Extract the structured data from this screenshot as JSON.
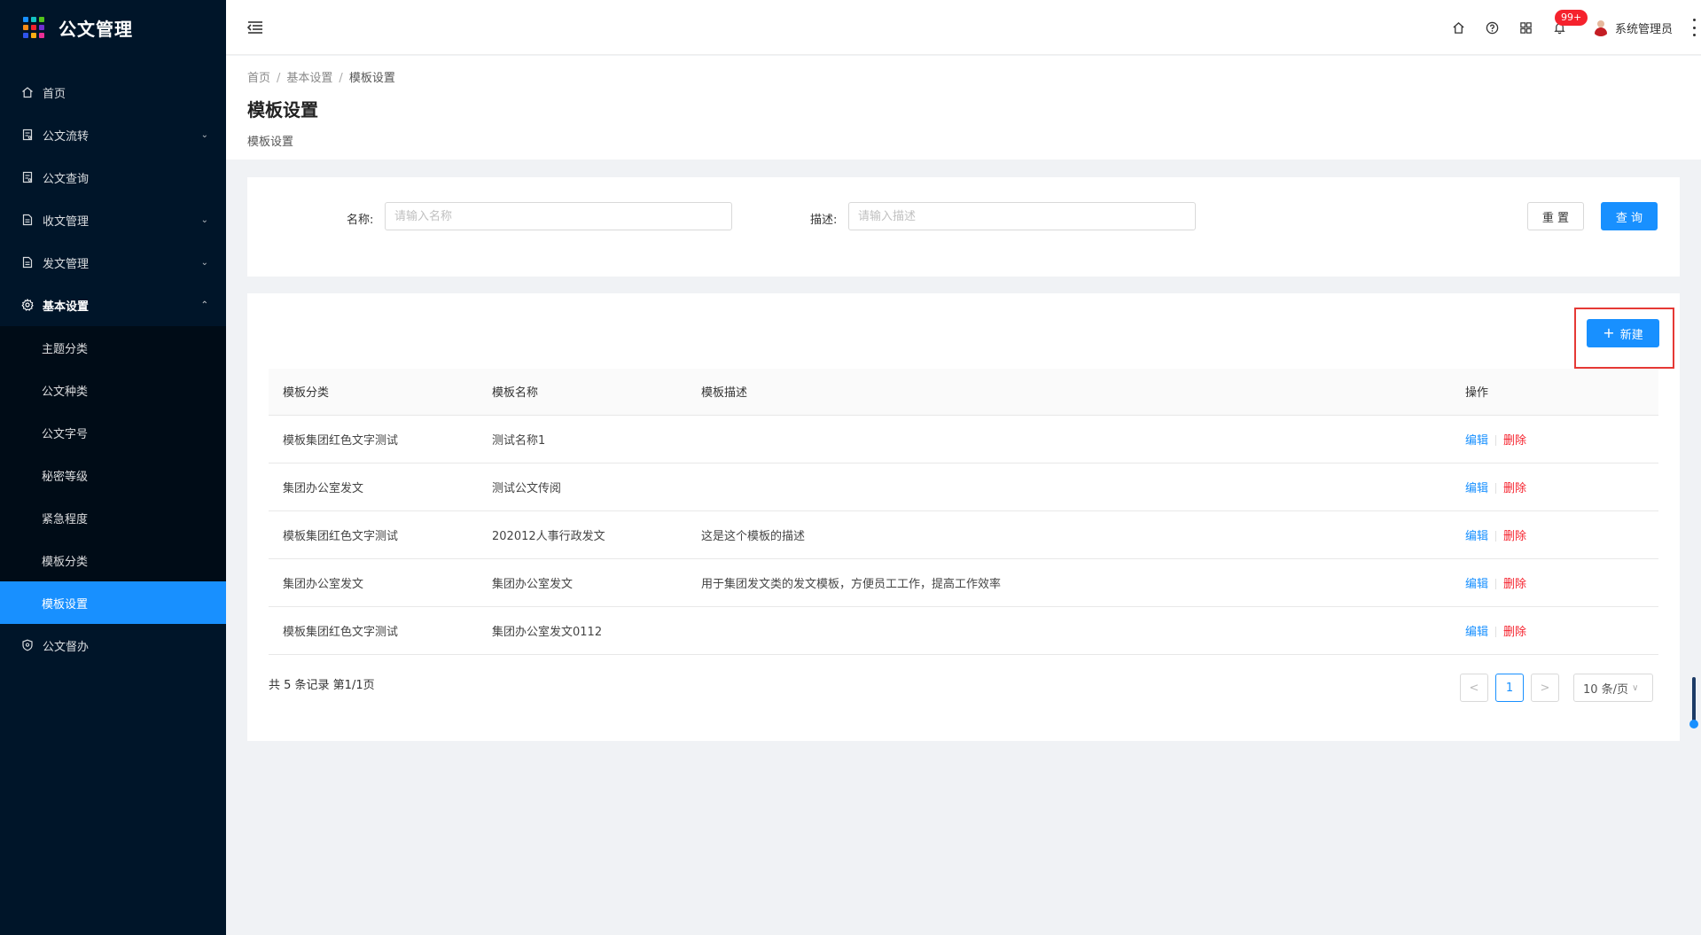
{
  "app": {
    "title": "公文管理"
  },
  "sidebar": {
    "logo_colors": [
      "#1890ff",
      "#13c2c2",
      "#52c41a",
      "#fa8c16",
      "#f5222d",
      "#722ed1",
      "#2f54eb",
      "#faad14",
      "#eb2f96"
    ],
    "items": [
      {
        "label": "首页",
        "icon": "home-icon"
      },
      {
        "label": "公文流转",
        "icon": "doc-icon",
        "arrow": "⌄"
      },
      {
        "label": "公文查询",
        "icon": "doc-icon"
      },
      {
        "label": "收文管理",
        "icon": "file-icon",
        "arrow": "⌄"
      },
      {
        "label": "发文管理",
        "icon": "file-icon",
        "arrow": "⌄"
      },
      {
        "label": "基本设置",
        "icon": "gear-icon",
        "arrow": "⌃"
      }
    ],
    "sub_items": [
      {
        "label": "主题分类"
      },
      {
        "label": "公文种类"
      },
      {
        "label": "公文字号"
      },
      {
        "label": "秘密等级"
      },
      {
        "label": "紧急程度"
      },
      {
        "label": "模板分类"
      },
      {
        "label": "模板设置"
      }
    ],
    "last_item": {
      "label": "公文督办",
      "icon": "shield-icon"
    }
  },
  "header": {
    "badge": "99+",
    "user_name": "系统管理员"
  },
  "breadcrumb": [
    "首页",
    "基本设置",
    "模板设置"
  ],
  "breadcrumb_sep": "/",
  "page": {
    "title": "模板设置",
    "subtitle": "模板设置"
  },
  "search": {
    "name_label": "名称:",
    "name_placeholder": "请输入名称",
    "desc_label": "描述:",
    "desc_placeholder": "请输入描述",
    "reset_label": "重 置",
    "query_label": "查 询"
  },
  "toolbar": {
    "new_label": "新建"
  },
  "table": {
    "columns": [
      "模板分类",
      "模板名称",
      "模板描述",
      "操作"
    ],
    "edit_label": "编辑",
    "delete_label": "删除",
    "rows": [
      {
        "category": "模板集团红色文字测试",
        "name": "测试名称1",
        "desc": ""
      },
      {
        "category": "集团办公室发文",
        "name": "测试公文传阅",
        "desc": ""
      },
      {
        "category": "模板集团红色文字测试",
        "name": "202012人事行政发文",
        "desc": "这是这个模板的描述"
      },
      {
        "category": "集团办公室发文",
        "name": "集团办公室发文",
        "desc": "用于集团发文类的发文模板，方便员工工作，提高工作效率"
      },
      {
        "category": "模板集团红色文字测试",
        "name": "集团办公室发文0112",
        "desc": ""
      }
    ]
  },
  "pagination": {
    "total_text": "共 5 条记录 第1/1页",
    "prev": "<",
    "current": "1",
    "next": ">",
    "page_size": "10 条/页"
  }
}
